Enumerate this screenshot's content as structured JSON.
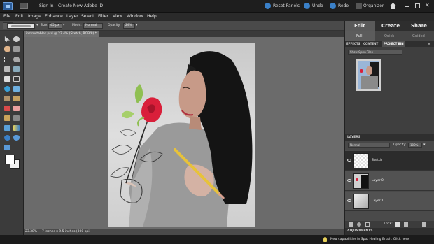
{
  "topbar": {
    "sign_in": "Sign In",
    "create_adobe_id": "Create New Adobe ID",
    "reset_panels": "Reset Panels",
    "undo": "Undo",
    "redo": "Redo",
    "organizer": "Organizer"
  },
  "menu": [
    "File",
    "Edit",
    "Image",
    "Enhance",
    "Layer",
    "Select",
    "Filter",
    "View",
    "Window",
    "Help"
  ],
  "options": {
    "size_label": "Size:",
    "size_value": "45 px",
    "mode_label": "Mode:",
    "mode_value": "Normal",
    "opacity_label": "Opacity:",
    "opacity_value": "29%"
  },
  "document": {
    "tab_title": "instructables.psd @ 23.4% (Sketch, RGB/8) *",
    "zoom": "23.38%",
    "doc_info": "7 inches x 9.5 inches (300 ppi)"
  },
  "panel": {
    "modes": [
      "Edit",
      "Create",
      "Share"
    ],
    "subtabs": [
      "Full",
      "Quick",
      "Guided"
    ],
    "panel_tabs": [
      "EFFECTS",
      "CONTENT",
      "PROJECT BIN",
      "≡"
    ],
    "bin_dropdown": "Show Open Files",
    "layers_title": "LAYERS",
    "blend_mode": "Normal",
    "opacity_label": "Opacity:",
    "opacity_value": "100%",
    "layers": [
      "Sketch",
      "Layer 0",
      "Layer 1"
    ],
    "lock_label": "Lock:",
    "adjustments_title": "ADJUSTMENTS"
  },
  "status_tip": "New capabilities in Spot Healing Brush. Click here",
  "colors": {
    "accent": "#6ea2e0",
    "rose": "#d91f3a",
    "pencil": "#e7c23a",
    "leaf": "#8fbf52"
  }
}
